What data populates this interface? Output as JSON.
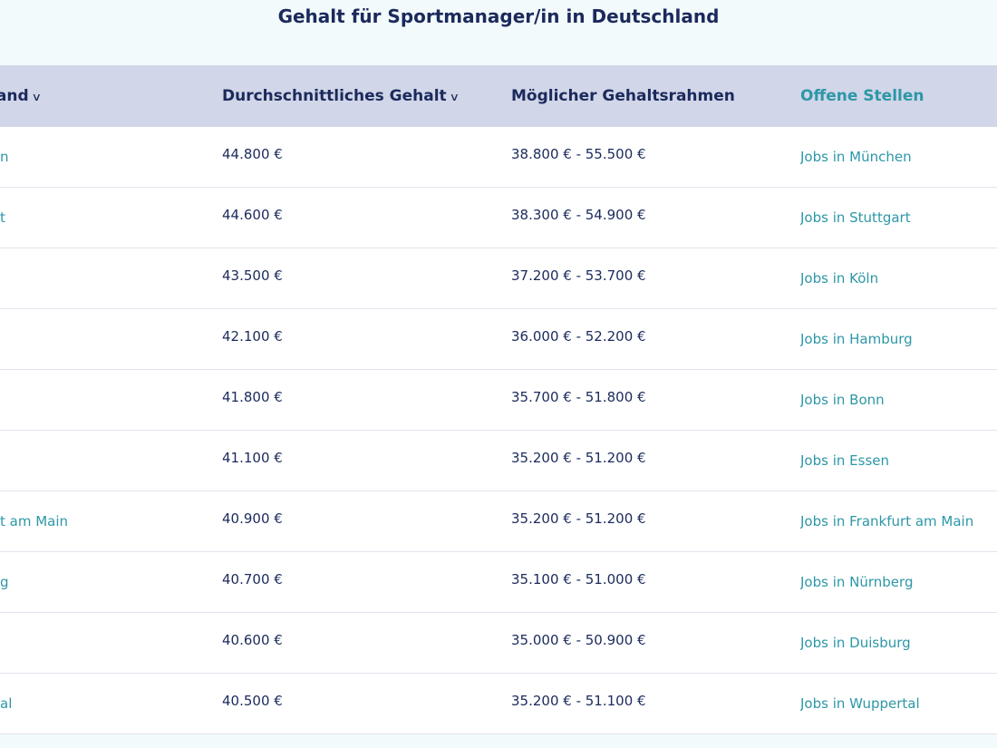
{
  "title": "Gehalt für Sportmanager/in in Deutschland",
  "table": {
    "headers": {
      "city": "nland",
      "avg": "Durchschnittliches Gehalt",
      "range": "Möglicher Gehaltsrahmen",
      "jobs": "Offene Stellen"
    },
    "sort_icon": "chevron-down-icon",
    "rows": [
      {
        "city": "n",
        "avg": "44.800 €",
        "range": "38.800 € - 55.500 €",
        "jobs": "Jobs in München"
      },
      {
        "city": "t",
        "avg": "44.600 €",
        "range": "38.300 € - 54.900 €",
        "jobs": "Jobs in Stuttgart"
      },
      {
        "city": "",
        "avg": "43.500 €",
        "range": "37.200 € - 53.700 €",
        "jobs": "Jobs in Köln"
      },
      {
        "city": "",
        "avg": "42.100 €",
        "range": "36.000 € - 52.200 €",
        "jobs": "Jobs in Hamburg"
      },
      {
        "city": "",
        "avg": "41.800 €",
        "range": "35.700 € - 51.800 €",
        "jobs": "Jobs in Bonn"
      },
      {
        "city": "",
        "avg": "41.100 €",
        "range": "35.200 € - 51.200 €",
        "jobs": "Jobs in Essen"
      },
      {
        "city": "t am Main",
        "avg": "40.900 €",
        "range": "35.200 € - 51.200 €",
        "jobs": "Jobs in Frankfurt am Main"
      },
      {
        "city": "g",
        "avg": "40.700 €",
        "range": "35.100 € - 51.000 €",
        "jobs": "Jobs in Nürnberg"
      },
      {
        "city": "",
        "avg": "40.600 €",
        "range": "35.000 € - 50.900 €",
        "jobs": "Jobs in Duisburg"
      },
      {
        "city": "al",
        "avg": "40.500 €",
        "range": "35.200 € - 51.100 €",
        "jobs": "Jobs in Wuppertal"
      }
    ]
  },
  "colors": {
    "heading": "#1b2a5c",
    "link": "#2d97a7",
    "header_bg": "#d1d6e8",
    "page_bg": "#f3fafb"
  }
}
